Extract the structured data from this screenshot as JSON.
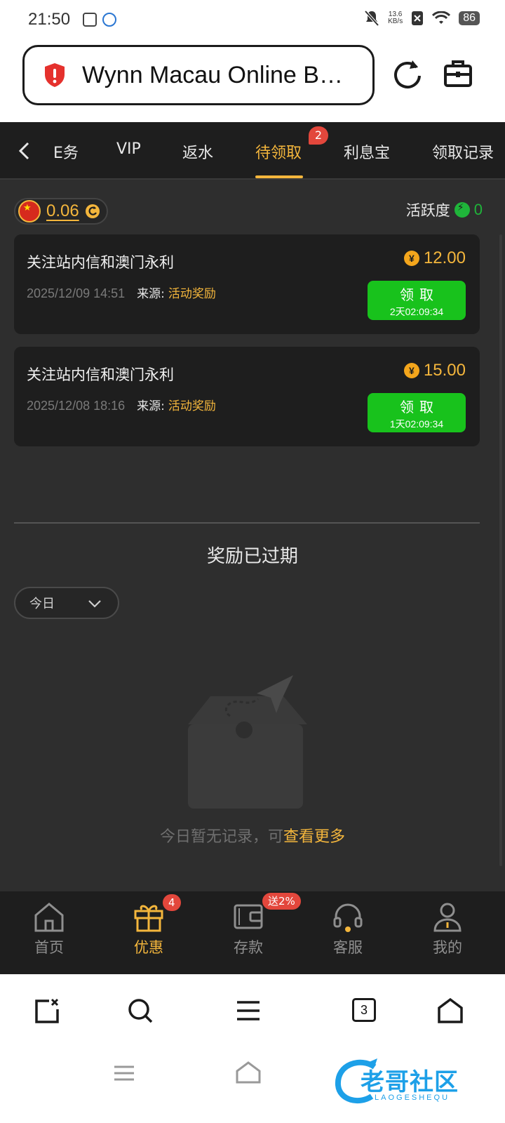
{
  "status_bar": {
    "time": "21:50",
    "net_speed_value": "13.6",
    "net_speed_unit": "KB/s",
    "battery": "86"
  },
  "browser": {
    "url_title": "Wynn Macau Online B…",
    "tab_count": "3"
  },
  "tabs": {
    "items": [
      {
        "label": "E务"
      },
      {
        "label": "VIP"
      },
      {
        "label": "返水"
      },
      {
        "label": "待领取"
      },
      {
        "label": "利息宝"
      },
      {
        "label": "领取记录"
      }
    ],
    "active_index": 3,
    "pending_badge": "2"
  },
  "account": {
    "balance": "0.06",
    "activity_label": "活跃度",
    "activity_value": "0"
  },
  "rewards": [
    {
      "title": "关注站内信和澳门永利",
      "amount": "12.00",
      "datetime": "2025/12/09 14:51",
      "source_label": "来源:",
      "source_value": "活动奖励",
      "claim_label": "领取",
      "countdown": "2天02:09:34"
    },
    {
      "title": "关注站内信和澳门永利",
      "amount": "15.00",
      "datetime": "2025/12/08 18:16",
      "source_label": "来源:",
      "source_value": "活动奖励",
      "claim_label": "领取",
      "countdown": "1天02:09:34"
    }
  ],
  "expired": {
    "title": "奖励已过期",
    "filter_value": "今日",
    "empty_text": "今日暂无记录，可",
    "more_link": "查看更多"
  },
  "app_nav": {
    "items": [
      {
        "label": "首页",
        "icon": "home-icon"
      },
      {
        "label": "优惠",
        "icon": "gift-icon",
        "badge": "4"
      },
      {
        "label": "存款",
        "icon": "wallet-icon",
        "badge": "送2%"
      },
      {
        "label": "客服",
        "icon": "headset-icon"
      },
      {
        "label": "我的",
        "icon": "user-icon"
      }
    ],
    "active_index": 1
  },
  "watermark": {
    "text": "老哥社区",
    "sub": "LAOGESHEQU"
  },
  "colors": {
    "accent": "#f4b63c",
    "claim_green": "#18c21c",
    "badge_red": "#e3473c",
    "bg_dark": "#2e2e2e",
    "card_dark": "#1e1e1e"
  }
}
